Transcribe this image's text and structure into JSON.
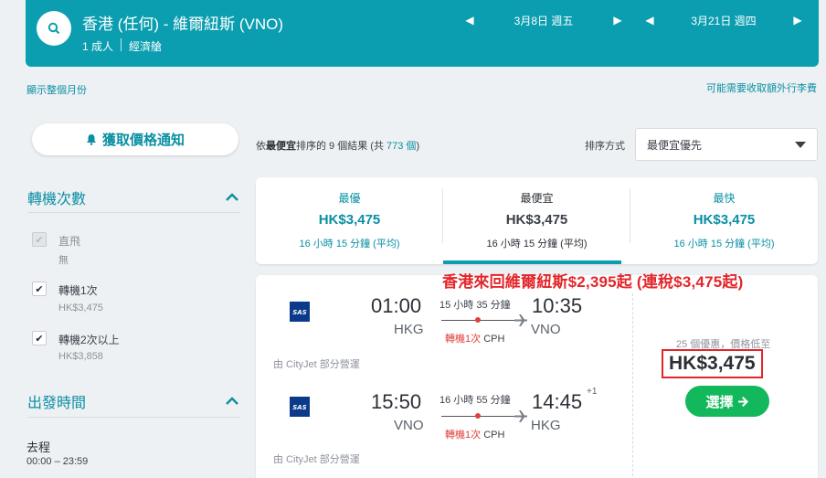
{
  "header": {
    "route": "香港 (任何) - 維爾紐斯 (VNO)",
    "travellers": "1 成人",
    "cabin": "經濟艙",
    "depart_date": "3月8日 週五",
    "return_date": "3月21日 週四"
  },
  "links": {
    "show_month": "顯示整個月份",
    "extra_fees": "可能需要收取額外行李費"
  },
  "alert": {
    "label": "獲取價格通知"
  },
  "filters": {
    "stops": {
      "title": "轉機次數",
      "options": [
        {
          "label": "直飛",
          "sub": "無",
          "checked": false,
          "disabled": true
        },
        {
          "label": "轉機1次",
          "sub": "HK$3,475",
          "checked": true,
          "disabled": false
        },
        {
          "label": "轉機2次以上",
          "sub": "HK$3,858",
          "checked": true,
          "disabled": false
        }
      ]
    },
    "depart_time": {
      "title": "出發時間",
      "leg_label": "去程",
      "range": "00:00 – 23:59"
    }
  },
  "results": {
    "prefix": "依",
    "sort_bold": "最便宜",
    "middle": "排序的 9 個結果 (共 ",
    "total": "773 個",
    "suffix": ")"
  },
  "sort": {
    "label": "排序方式",
    "selected": "最便宜優先"
  },
  "tabs": [
    {
      "title": "最優",
      "price": "HK$3,475",
      "time": "16 小時 15 分鐘 (平均)"
    },
    {
      "title": "最便宜",
      "price": "HK$3,475",
      "time": "16 小時 15 分鐘 (平均)"
    },
    {
      "title": "最快",
      "price": "HK$3,475",
      "time": "16 小時 15 分鐘 (平均)"
    }
  ],
  "promo": "香港來回維爾紐斯$2,395起 (連稅$3,475起)",
  "card": {
    "outbound": {
      "depart_time": "01:00",
      "depart_apt": "HKG",
      "duration": "15 小時 35 分鐘",
      "stops_red": "轉機1次",
      "stop_apt": "CPH",
      "arrive_time": "10:35",
      "arrive_apt": "VNO",
      "operated": "由 CityJet 部分營運",
      "plus_days": ""
    },
    "inbound": {
      "depart_time": "15:50",
      "depart_apt": "VNO",
      "duration": "16 小時 55 分鐘",
      "stops_red": "轉機1次",
      "stop_apt": "CPH",
      "arrive_time": "14:45",
      "arrive_apt": "HKG",
      "operated": "由 CityJet 部分營運",
      "plus_days": "+1"
    },
    "logo_text": "SAS",
    "deals": "25 個優惠，價格低至",
    "price": "HK$3,475",
    "select": "選擇"
  },
  "colors": {
    "brand": "#0a9eb0",
    "select": "#14b85c",
    "alert_red": "#e3262b"
  }
}
